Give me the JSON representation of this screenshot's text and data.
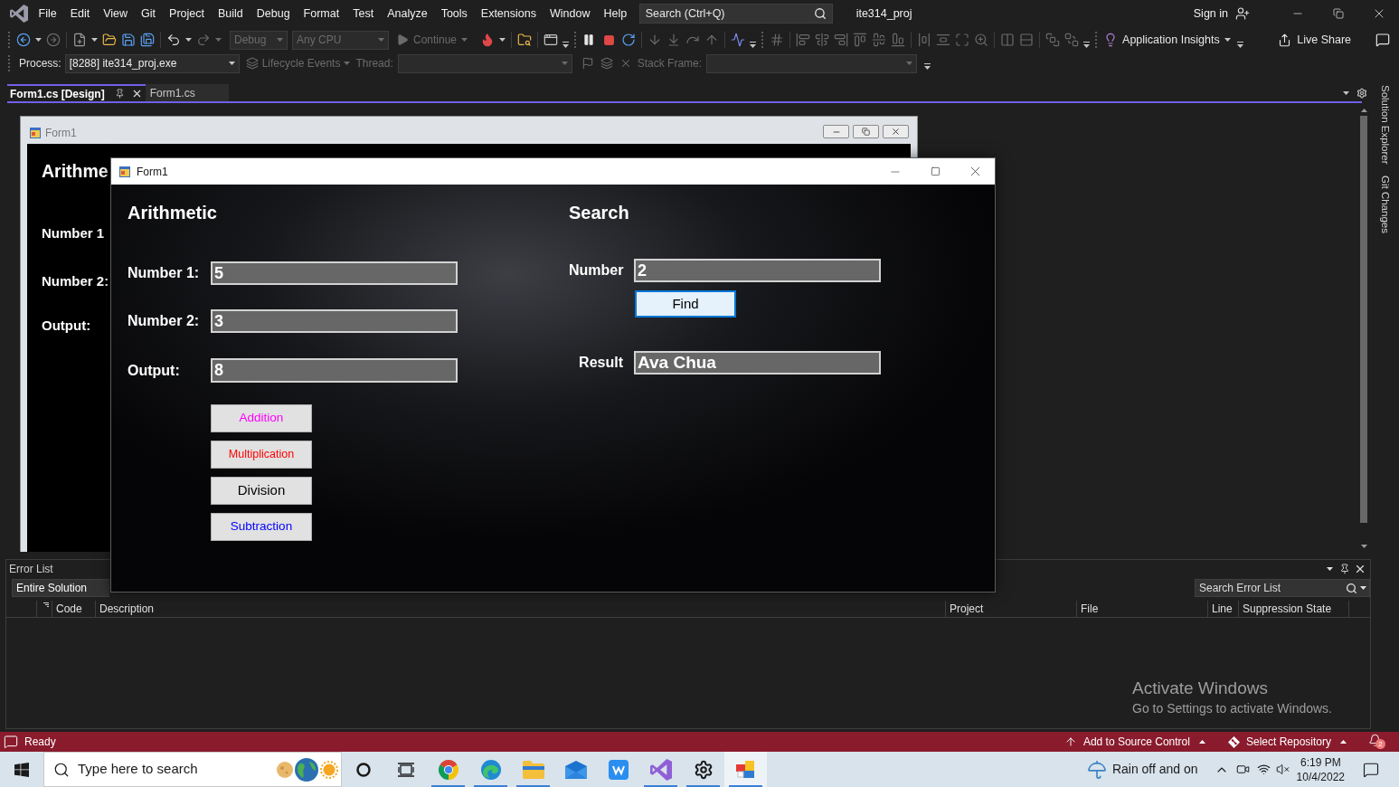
{
  "menu_bar": {
    "items": [
      "File",
      "Edit",
      "View",
      "Git",
      "Project",
      "Build",
      "Debug",
      "Format",
      "Test",
      "Analyze",
      "Tools",
      "Extensions",
      "Window",
      "Help"
    ],
    "search": {
      "placeholder": "Search (Ctrl+Q)"
    },
    "solution_name": "ite314_proj",
    "sign_in": "Sign in"
  },
  "toolbar": {
    "configuration": {
      "value": "Debug",
      "disabled": true
    },
    "platform": {
      "value": "Any CPU",
      "disabled": true
    },
    "continue": {
      "label": "Continue",
      "disabled": true
    },
    "insights": {
      "label": "Application Insights"
    },
    "live_share": {
      "label": "Live Share"
    }
  },
  "debug_location": {
    "process": {
      "label": "Process:",
      "value": "[8288] ite314_proj.exe"
    },
    "lifecycle": {
      "label": "Lifecycle Events",
      "disabled": true
    },
    "thread": {
      "label": "Thread:",
      "disabled": true
    },
    "stack_frame": {
      "label": "Stack Frame:",
      "disabled": true
    }
  },
  "document_tabs": [
    {
      "label": "Form1.cs [Design]",
      "selected": true
    },
    {
      "label": "Form1.cs",
      "selected": false
    }
  ],
  "designer_form": {
    "title": "Form1",
    "heading": "Arithme",
    "labels": [
      "Number 1",
      "Number 2:",
      "Output:"
    ]
  },
  "side_tabs": [
    "Solution Explorer",
    "Git Changes"
  ],
  "error_list": {
    "title": "Error List",
    "scope": "Entire Solution",
    "search": {
      "placeholder": "Search Error List"
    },
    "columns": [
      "Code",
      "Description",
      "Project",
      "File",
      "Line",
      "Suppression State"
    ]
  },
  "activation_notice": {
    "title": "Activate Windows",
    "text": "Go to Settings to activate Windows."
  },
  "status_bar": {
    "text": "Ready",
    "source_control": "Add to Source Control",
    "repository": "Select Repository",
    "notification_count": "2"
  },
  "running_form": {
    "title": "Form1",
    "arithmetic": {
      "heading": "Arithmetic",
      "fields": [
        {
          "label": "Number 1:",
          "value": "5"
        },
        {
          "label": "Number 2:",
          "value": "3"
        },
        {
          "label": "Output:",
          "value": "8"
        }
      ],
      "buttons": [
        {
          "label": "Addition",
          "color": "#ff00ff"
        },
        {
          "label": "Multiplication",
          "color": "#ff0000"
        },
        {
          "label": "Division",
          "color": "#000000"
        },
        {
          "label": "Subtraction",
          "color": "#0000ff"
        }
      ]
    },
    "search": {
      "heading": "Search",
      "number": {
        "label": "Number",
        "value": "2"
      },
      "find_button": {
        "label": "Find",
        "focused": true
      },
      "result": {
        "label": "Result",
        "value": "Ava Chua"
      }
    }
  },
  "taskbar": {
    "search": {
      "placeholder": "Type here to search"
    },
    "apps": [
      {
        "running": true,
        "selected": false
      },
      {
        "running": true,
        "selected": false
      },
      {
        "running": true,
        "selected": false
      },
      {
        "running": false,
        "selected": false
      },
      {
        "running": false,
        "selected": false
      },
      {
        "running": true,
        "selected": false
      },
      {
        "running": true,
        "selected": false
      },
      {
        "running": true,
        "selected": true
      }
    ],
    "weather": "Rain off and on",
    "time": "6:19 PM",
    "date": "10/4/2022"
  }
}
